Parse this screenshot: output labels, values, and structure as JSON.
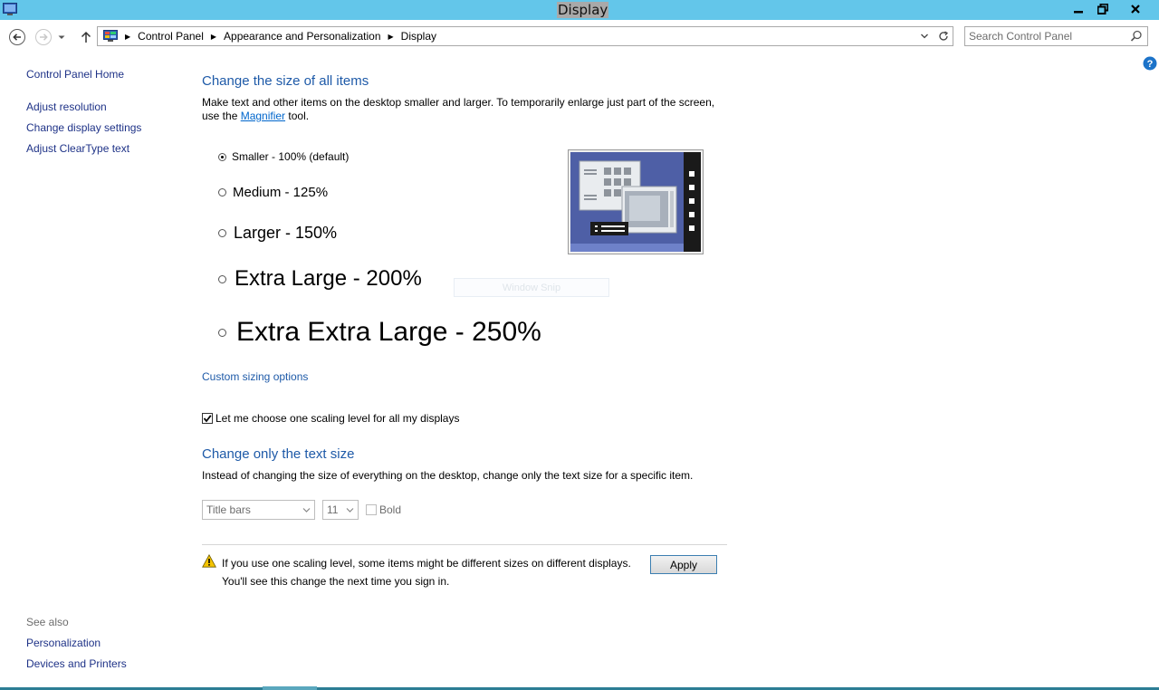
{
  "window": {
    "title": "Display"
  },
  "address": {
    "crumbs": [
      "Control Panel",
      "Appearance and Personalization",
      "Display"
    ]
  },
  "search": {
    "placeholder": "Search Control Panel"
  },
  "sidebar": {
    "home": "Control Panel Home",
    "items": [
      "Adjust resolution",
      "Change display settings",
      "Adjust ClearType text"
    ],
    "see_also_label": "See also",
    "see_also": [
      "Personalization",
      "Devices and Printers"
    ]
  },
  "size_section": {
    "heading": "Change the size of all items",
    "desc_before": "Make text and other items on the desktop smaller and larger. To temporarily enlarge just part of the screen, use the ",
    "magnifier_link": "Magnifier",
    "desc_after": " tool.",
    "options": [
      {
        "label": "Smaller - 100% (default)",
        "selected": true
      },
      {
        "label": "Medium - 125%",
        "selected": false
      },
      {
        "label": "Larger - 150%",
        "selected": false
      },
      {
        "label": "Extra Large - 200%",
        "selected": false
      },
      {
        "label": "Extra Extra Large - 250%",
        "selected": false
      }
    ],
    "custom_link": "Custom sizing options",
    "one_scaling_label": "Let me choose one scaling level for all my displays",
    "one_scaling_checked": true
  },
  "overlay": {
    "snip_label": "Window Snip"
  },
  "text_section": {
    "heading": "Change only the text size",
    "desc": "Instead of changing the size of everything on the desktop, change only the text size for a specific item.",
    "item_select": "Title bars",
    "size_select": "11",
    "bold_label": "Bold"
  },
  "warning": {
    "line1": "If you use one scaling level, some items might be different sizes on different displays.",
    "line2": "You'll see this change the next time you sign in."
  },
  "apply_label": "Apply",
  "colors": {
    "titlebar": "#63c6ea",
    "heading": "#1e5aa8",
    "link": "#1e3287"
  }
}
